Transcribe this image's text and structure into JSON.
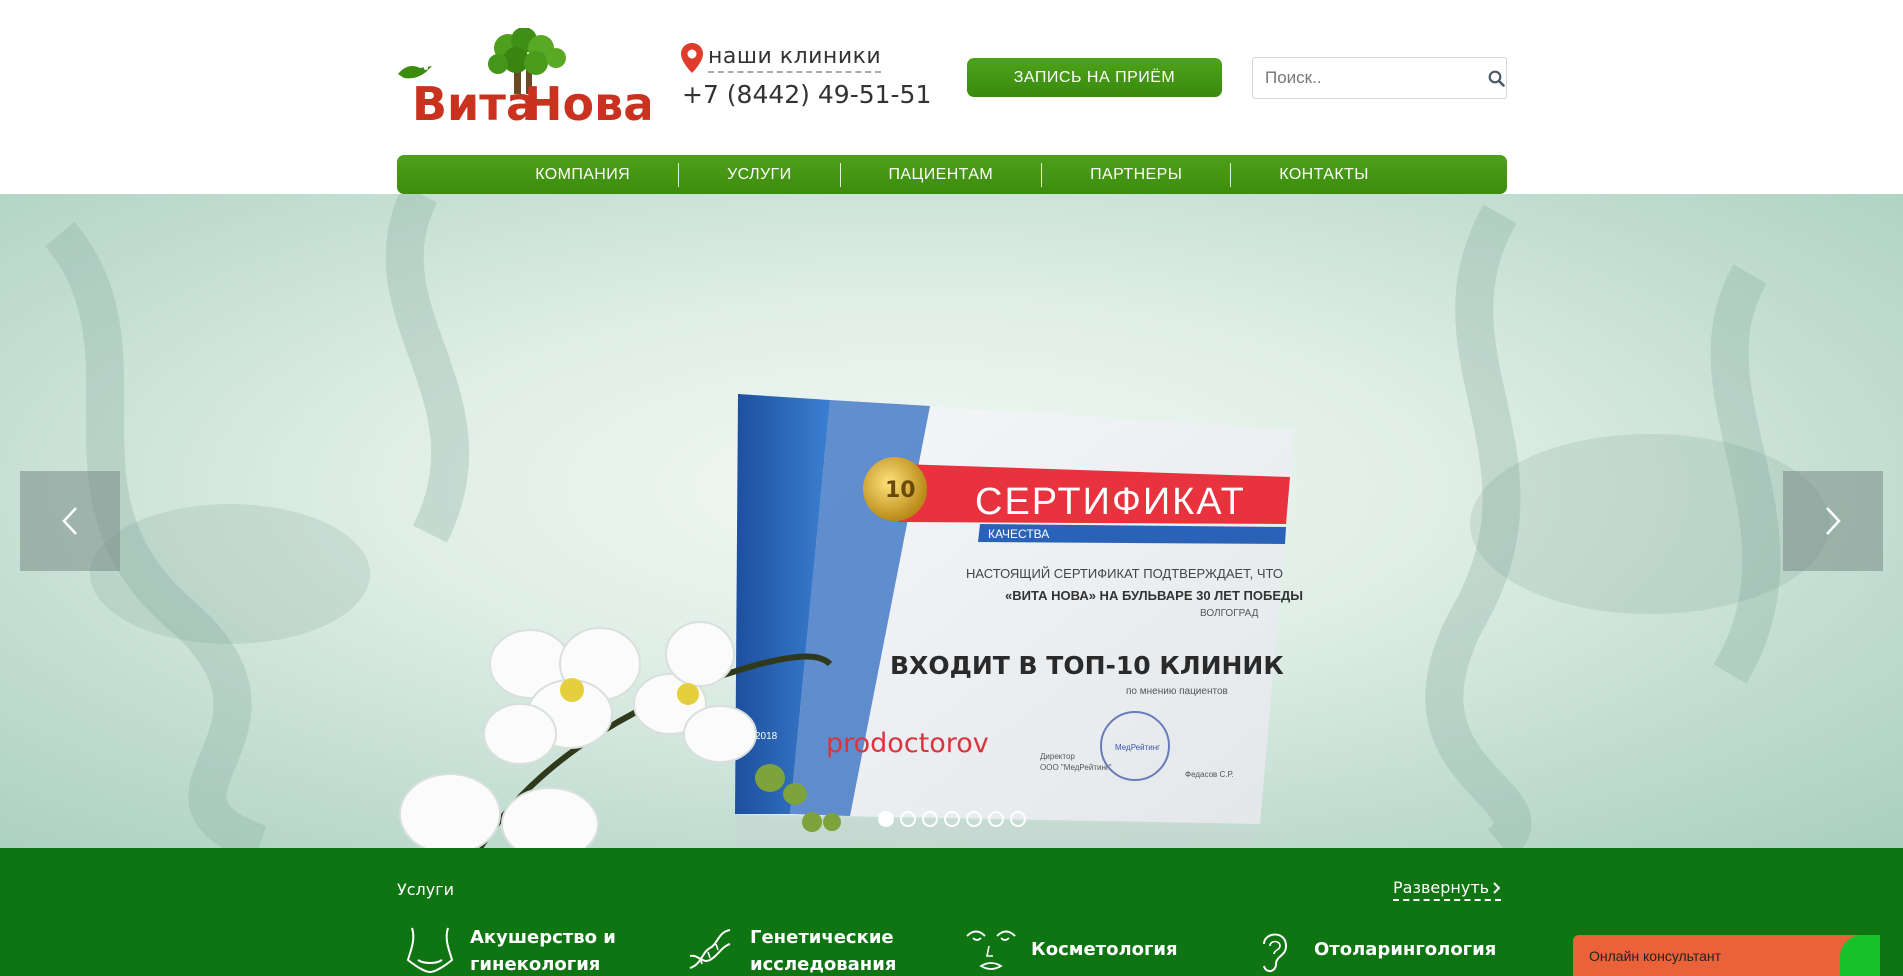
{
  "header": {
    "logo_text": "ВитаНова",
    "clinics_label": "наши клиники",
    "phone": "+7 (8442) 49-51-51",
    "appointment_button": "ЗАПИСЬ НА ПРИЁМ",
    "search": {
      "placeholder": "Поиск..",
      "value": ""
    }
  },
  "nav": {
    "items": [
      {
        "label": "КОМПАНИЯ"
      },
      {
        "label": "УСЛУГИ"
      },
      {
        "label": "ПАЦИЕНТАМ"
      },
      {
        "label": "ПАРТНЕРЫ"
      },
      {
        "label": "КОНТАКТЫ"
      }
    ]
  },
  "slider": {
    "slide_count": 7,
    "active_slide": 1,
    "slide_text": {
      "headline": "СЕРТИФИКАТ",
      "sub": "КАЧЕСТВА",
      "line1": "НАСТОЯЩИЙ СЕРТИФИКАТ ПОДТВЕРЖДАЕТ, ЧТО",
      "line2": "«ВИТА НОВА» НА БУЛЬВАРЕ 30 ЛЕТ ПОБЕДЫ",
      "city": "ВОЛГОГРАД",
      "main": "ВХОДИТ В ТОП-10 КЛИНИК",
      "small": "по мнению пациентов",
      "year": "2018",
      "brand": "prodoctorov",
      "badge": "10",
      "director": "Директор",
      "company": "ООО \"МедРейтинг\"",
      "signature": "Федасов С.Р.",
      "stamp": "МедРейтинг"
    }
  },
  "services": {
    "title": "Услуги",
    "expand_label": "Развернуть",
    "items": [
      {
        "line1": "Акушерство и",
        "line2": "гинекология",
        "icon": "pelvis-icon"
      },
      {
        "line1": "Генетические",
        "line2": "исследования",
        "icon": "dna-icon"
      },
      {
        "line1": "Косметология",
        "line2": "",
        "icon": "face-icon"
      },
      {
        "line1": "Отоларингология",
        "line2": "",
        "icon": "ear-icon"
      }
    ]
  },
  "consultant": {
    "label": "Онлайн консультант"
  },
  "colors": {
    "brand_green": "#3c8c0e",
    "services_bg": "#0f7412",
    "logo_red": "#c8321e",
    "consultant_orange": "#e9623a"
  }
}
